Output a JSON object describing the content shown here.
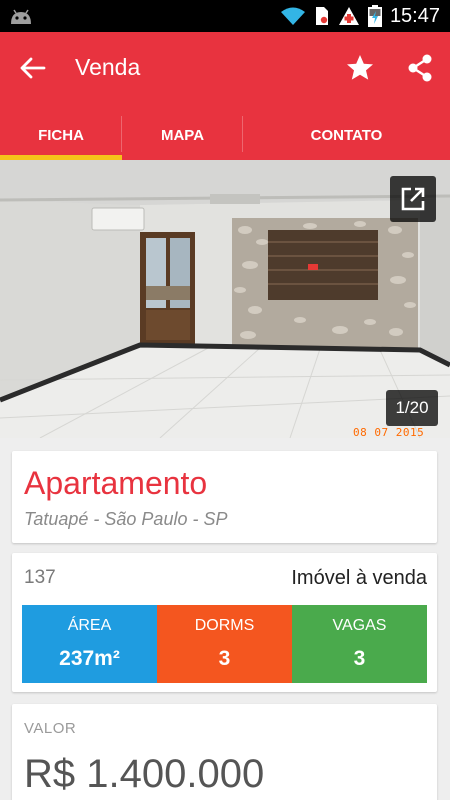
{
  "status_bar": {
    "time": "15:47",
    "icons": [
      "android-icon",
      "wifi-icon",
      "sim-icon",
      "health-alert-icon",
      "battery-charging-icon"
    ]
  },
  "toolbar": {
    "title": "Venda",
    "back_icon": "arrow-back-icon",
    "favorite_icon": "star-icon",
    "share_icon": "share-icon",
    "color": "#e8333f"
  },
  "tabs": [
    {
      "label": "FICHA",
      "active": true
    },
    {
      "label": "MAPA",
      "active": false
    },
    {
      "label": "CONTATO",
      "active": false
    }
  ],
  "gallery": {
    "counter": "1/20",
    "date_stamp": "08 07 2015",
    "open_icon": "open-external-icon"
  },
  "property": {
    "type": "Apartamento",
    "location": "Tatuapé - São Paulo - SP",
    "reference": "137",
    "status": "Imóvel à venda"
  },
  "stats": [
    {
      "label": "ÁREA",
      "value": "237m²",
      "color": "#1f9ce0"
    },
    {
      "label": "DORMS",
      "value": "3",
      "color": "#f4561f"
    },
    {
      "label": "VAGAS",
      "value": "3",
      "color": "#4aaa4c"
    }
  ],
  "price": {
    "label": "VALOR",
    "value": "R$ 1.400.000"
  }
}
